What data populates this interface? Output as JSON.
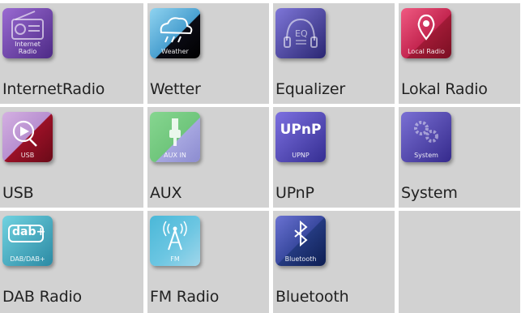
{
  "tiles": [
    {
      "label": "InternetRadio",
      "caption": "Internet\nRadio",
      "icon": "radio-icon",
      "colors": [
        "#8a5cc4",
        "#4d2a86"
      ]
    },
    {
      "label": "Wetter",
      "caption": "Weather",
      "icon": "weather-cloud-icon",
      "colors": [
        "#6fc5e8",
        "#0a0a14"
      ]
    },
    {
      "label": "Equalizer",
      "caption": "",
      "icon": "equalizer-headphones-icon",
      "colors": [
        "#6b62c9",
        "#2d2a78"
      ]
    },
    {
      "label": "Lokal Radio",
      "caption": "Local Radio",
      "icon": "location-pin-icon",
      "colors": [
        "#e0426e",
        "#8c1630"
      ]
    },
    {
      "label": "USB",
      "caption": "USB",
      "icon": "usb-play-icon",
      "colors": [
        "#c9a0d8",
        "#7a0f1e"
      ]
    },
    {
      "label": "AUX",
      "caption": "AUX IN",
      "icon": "aux-plug-icon",
      "colors": [
        "#7ed08a",
        "#9a9ad8"
      ]
    },
    {
      "label": "UPnP",
      "caption": "UPNP",
      "icon": "upnp-icon",
      "colors": [
        "#7266d8",
        "#3c3499"
      ],
      "logo": "UPnP"
    },
    {
      "label": "System",
      "caption": "System",
      "icon": "gears-icon",
      "colors": [
        "#6a62c8",
        "#3a2f94"
      ]
    },
    {
      "label": "DAB Radio",
      "caption": "DAB/DAB+",
      "icon": "dab-icon",
      "colors": [
        "#64c8d8",
        "#2f8fa8"
      ],
      "logo": "dab+"
    },
    {
      "label": "FM Radio",
      "caption": "FM",
      "icon": "fm-antenna-icon",
      "colors": [
        "#5ac4dc",
        "#86c8e0"
      ]
    },
    {
      "label": "Bluetooth",
      "caption": "Bluetooth",
      "icon": "bluetooth-icon",
      "colors": [
        "#6068c8",
        "#203070"
      ]
    }
  ]
}
